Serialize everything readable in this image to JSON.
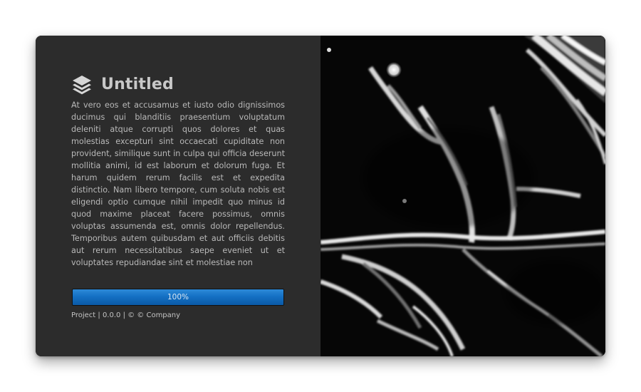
{
  "app": {
    "title": "Untitled",
    "logo_icon": "layers-icon"
  },
  "description": "At vero eos et accusamus et iusto odio dignissimos ducimus qui blanditiis praesentium voluptatum deleniti atque corrupti quos dolores et quas molestias excepturi sint occaecati cupiditate non provident, similique sunt in culpa qui officia deserunt mollitia animi, id est laborum et dolorum fuga. Et harum quidem rerum facilis est et expedita distinctio. Nam libero tempore, cum soluta nobis est eligendi optio cumque nihil impedit quo minus id quod maxime placeat facere possimus, omnis voluptas assumenda est, omnis dolor repellendus. Temporibus autem quibusdam et aut officiis debitis aut rerum necessitatibus saepe eveniet ut et voluptates repudiandae sint et molestiae non",
  "progress": {
    "value": 1.0,
    "label": "100%",
    "fill_color": "#1470c4"
  },
  "footer": {
    "text": "Project | 0.0.0 | © © Company"
  },
  "colors": {
    "panel_background": "#2c2c2c",
    "image_background": "#050505"
  }
}
